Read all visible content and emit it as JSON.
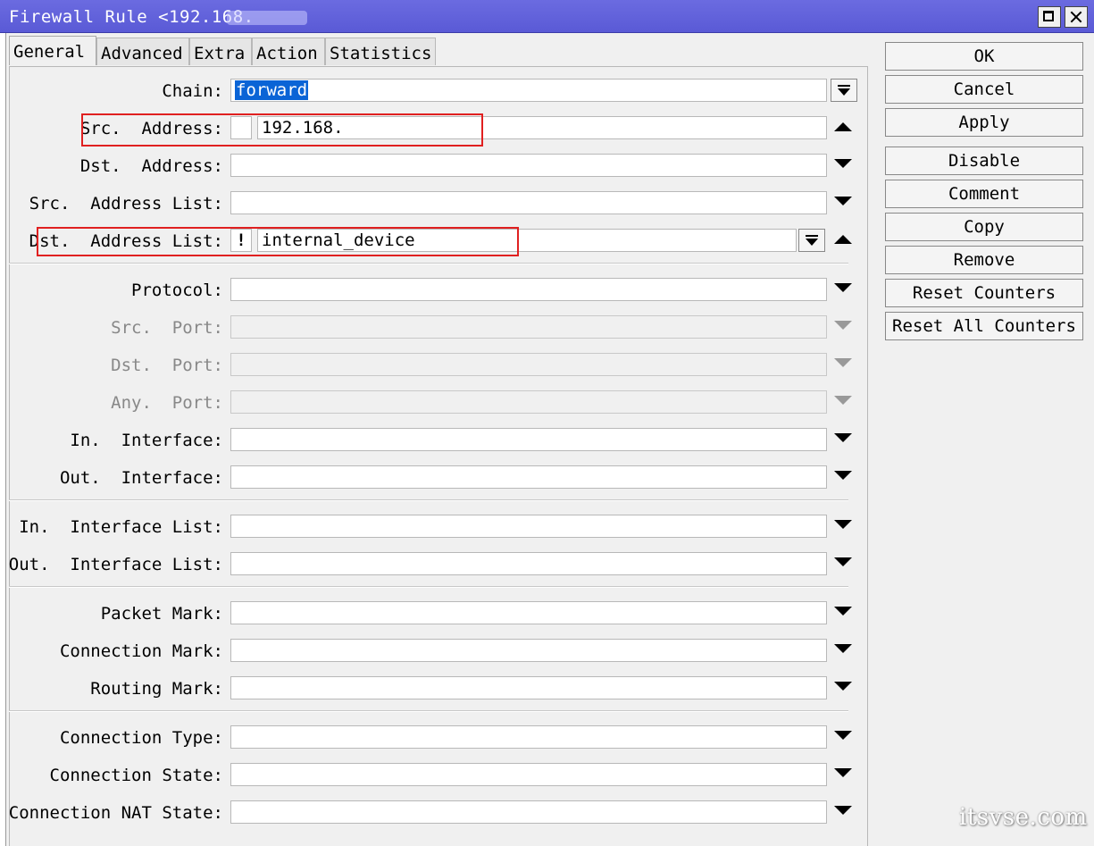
{
  "window": {
    "title": "Firewall Rule <192.168."
  },
  "tabs": [
    "General",
    "Advanced",
    "Extra",
    "Action",
    "Statistics"
  ],
  "fields": {
    "chain": {
      "label": "Chain:",
      "value": "forward"
    },
    "src_address": {
      "label": "Src.  Address:",
      "value": "192.168."
    },
    "dst_address": {
      "label": "Dst.  Address:",
      "value": ""
    },
    "src_address_list": {
      "label": "Src.  Address List:",
      "value": ""
    },
    "dst_address_list": {
      "label": "Dst.  Address List:",
      "not": "!",
      "value": "internal_device"
    },
    "protocol": {
      "label": "Protocol:",
      "value": ""
    },
    "src_port": {
      "label": "Src.  Port:",
      "value": ""
    },
    "dst_port": {
      "label": "Dst.  Port:",
      "value": ""
    },
    "any_port": {
      "label": "Any.  Port:",
      "value": ""
    },
    "in_interface": {
      "label": "In.  Interface:",
      "value": ""
    },
    "out_interface": {
      "label": "Out.  Interface:",
      "value": ""
    },
    "in_interface_list": {
      "label": "In.  Interface List:",
      "value": ""
    },
    "out_interface_list": {
      "label": "Out.  Interface List:",
      "value": ""
    },
    "packet_mark": {
      "label": "Packet Mark:",
      "value": ""
    },
    "connection_mark": {
      "label": "Connection Mark:",
      "value": ""
    },
    "routing_mark": {
      "label": "Routing Mark:",
      "value": ""
    },
    "connection_type": {
      "label": "Connection Type:",
      "value": ""
    },
    "connection_state": {
      "label": "Connection State:",
      "value": ""
    },
    "connection_nat_state": {
      "label": "Connection NAT State:",
      "value": ""
    }
  },
  "buttons": {
    "ok": "OK",
    "cancel": "Cancel",
    "apply": "Apply",
    "disable": "Disable",
    "comment": "Comment",
    "copy": "Copy",
    "remove": "Remove",
    "reset_counters": "Reset Counters",
    "reset_all_counters": "Reset All Counters"
  },
  "watermark": "itsvse.com",
  "colors": {
    "titlebar": "#5a5ad6",
    "selection": "#0a64d6",
    "highlight_box": "#e02020"
  }
}
